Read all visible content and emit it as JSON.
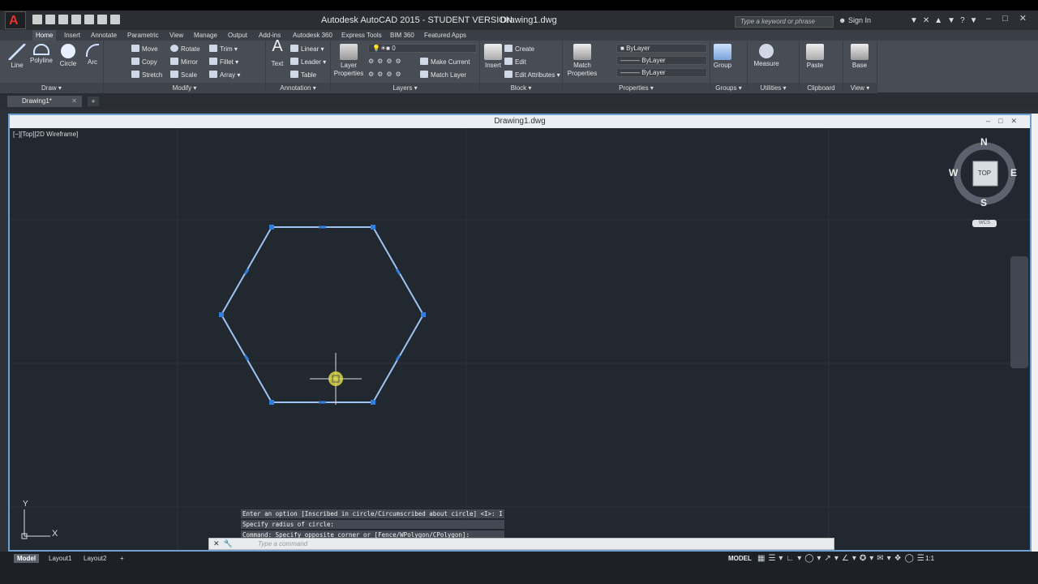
{
  "app": {
    "title": "Autodesk AutoCAD 2015 - STUDENT VERSION",
    "file": "Drawing1.dwg",
    "logo": "A",
    "search_placeholder": "Type a keyword or phrase",
    "sign_in": "Sign In"
  },
  "ribbon_tabs": [
    "Home",
    "Insert",
    "Annotate",
    "Parametric",
    "View",
    "Manage",
    "Output",
    "Add-ins",
    "Autodesk 360",
    "Express Tools",
    "BIM 360",
    "Featured Apps"
  ],
  "panels": {
    "draw": {
      "title": "Draw",
      "line": "Line",
      "polyline": "Polyline",
      "circle": "Circle",
      "arc": "Arc"
    },
    "modify": {
      "title": "Modify",
      "move": "Move",
      "rotate": "Rotate",
      "trim": "Trim",
      "copy": "Copy",
      "mirror": "Mirror",
      "fillet": "Fillet",
      "stretch": "Stretch",
      "scale": "Scale",
      "array": "Array"
    },
    "annotation": {
      "title": "Annotation",
      "text": "Text",
      "linear": "Linear",
      "leader": "Leader",
      "table": "Table"
    },
    "layers": {
      "title": "Layers",
      "layer_properties": "Layer Properties",
      "layer_value": "0",
      "make_current": "Make Current",
      "match_layer": "Match Layer"
    },
    "block": {
      "title": "Block",
      "insert": "Insert",
      "create": "Create",
      "edit": "Edit",
      "edit_attributes": "Edit Attributes"
    },
    "properties": {
      "title": "Properties",
      "match": "Match Properties",
      "color": "ByLayer",
      "linetype": "ByLayer",
      "lineweight": "ByLayer"
    },
    "groups": {
      "title": "Groups",
      "group": "Group"
    },
    "utilities": {
      "title": "Utilities",
      "measure": "Measure"
    },
    "clipboard": {
      "title": "Clipboard",
      "paste": "Paste"
    },
    "view": {
      "title": "View",
      "base": "Base"
    }
  },
  "document_tab": "Drawing1*",
  "viewport": {
    "title": "Drawing1.dwg",
    "label": "[−][Top][2D Wireframe]",
    "viewcube": {
      "n": "N",
      "s": "S",
      "e": "E",
      "w": "W",
      "face": "TOP",
      "wcs": "WCS"
    },
    "ucs": {
      "x": "X",
      "y": "Y"
    }
  },
  "command": {
    "history": [
      "Enter an option [Inscribed in circle/Circumscribed about circle] <I>: I",
      "Specify radius of circle:",
      "Command: Specify opposite corner or [Fence/WPolygon/CPolygon]:"
    ],
    "placeholder": "Type a command"
  },
  "layout_tabs": [
    "Model",
    "Layout1",
    "Layout2"
  ],
  "status": {
    "model": "MODEL",
    "scale": "1:1"
  },
  "colors": {
    "selection": "#2f7fe0",
    "hexagon": "#9ec3f0",
    "canvas": "#212830",
    "cursor": "#e8e24a"
  }
}
